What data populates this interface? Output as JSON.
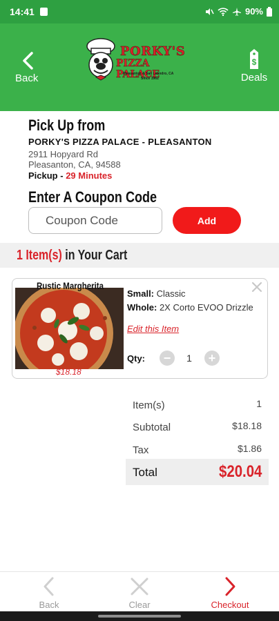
{
  "status_bar": {
    "time": "14:41",
    "battery": "90%",
    "icons": [
      "app-notification-icon",
      "mute-icon",
      "wifi-icon",
      "airplane-icon",
      "battery-icon"
    ]
  },
  "header": {
    "back_label": "Back",
    "deals_label": "Deals",
    "logo": {
      "line1": "PORKY'S",
      "line2": "PIZZA PALACE",
      "sub1": "Pleasanton & San Leandro, CA",
      "sub2": "Since 1962"
    },
    "colors": {
      "background": "#3bb14a",
      "brand_red": "#d9232a"
    }
  },
  "pickup": {
    "title": "Pick Up from",
    "store_name": "PORKY'S PIZZA PALACE - PLEASANTON",
    "address_line1": "2911 Hopyard Rd",
    "address_line2": "Pleasanton, CA, 94588",
    "time_label": "Pickup -",
    "time_value": "29 Minutes"
  },
  "coupon": {
    "title": "Enter A Coupon Code",
    "placeholder": "Coupon Code",
    "add_label": "Add"
  },
  "cart": {
    "count_text": "1 Item(s)",
    "title_suffix": "in Your Cart",
    "items": [
      {
        "name": "Rustic Margherita",
        "price": "$18.18",
        "size_label": "Small:",
        "size_value": "Classic",
        "whole_label": "Whole:",
        "whole_value": "2X Corto EVOO Drizzle",
        "edit_label": "Edit this Item",
        "qty_label": "Qty:",
        "qty_value": "1",
        "qty_minus": "−",
        "qty_plus": "+"
      }
    ]
  },
  "totals": {
    "items_label": "Item(s)",
    "items_value": "1",
    "subtotal_label": "Subtotal",
    "subtotal_value": "$18.18",
    "tax_label": "Tax",
    "tax_value": "$1.86",
    "total_label": "Total",
    "total_value": "$20.04"
  },
  "bottom_nav": {
    "back_label": "Back",
    "clear_label": "Clear",
    "checkout_label": "Checkout"
  }
}
